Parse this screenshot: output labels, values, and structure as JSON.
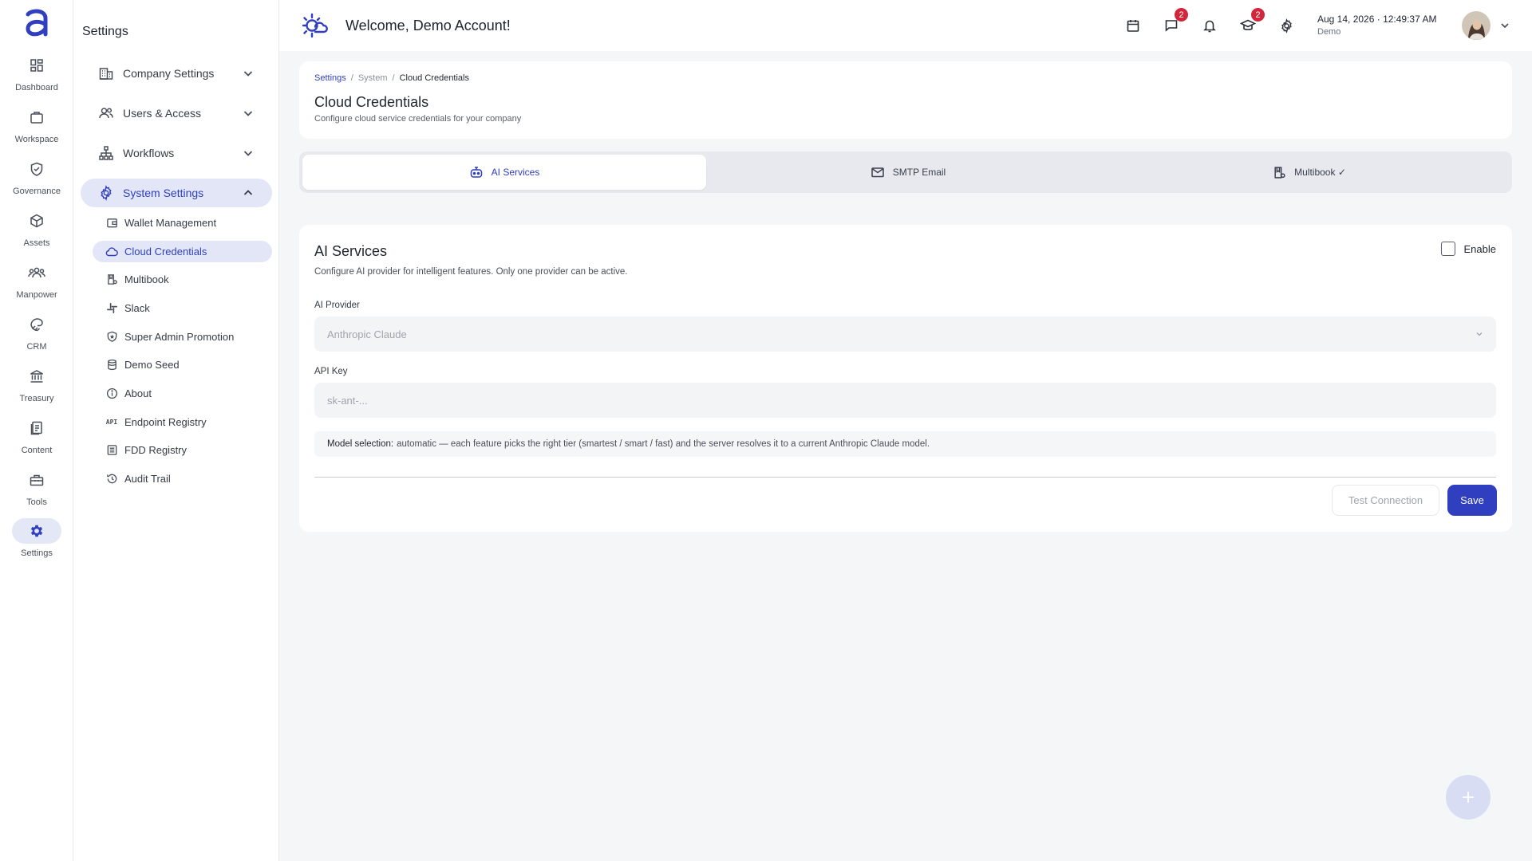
{
  "rail": {
    "items": [
      {
        "label": "Dashboard",
        "icon": "dashboard-icon"
      },
      {
        "label": "Workspace",
        "icon": "briefcase-icon"
      },
      {
        "label": "Governance",
        "icon": "shield-check-icon"
      },
      {
        "label": "Assets",
        "icon": "cube-icon"
      },
      {
        "label": "Manpower",
        "icon": "people-icon"
      },
      {
        "label": "CRM",
        "icon": "handshake-icon"
      },
      {
        "label": "Treasury",
        "icon": "bank-icon"
      },
      {
        "label": "Content",
        "icon": "document-icon"
      },
      {
        "label": "Tools",
        "icon": "toolbox-icon"
      },
      {
        "label": "Settings",
        "icon": "gear-icon",
        "active": true
      }
    ]
  },
  "sidebar": {
    "title": "Settings",
    "groups": [
      {
        "label": "Company Settings",
        "icon": "building-icon"
      },
      {
        "label": "Users & Access",
        "icon": "users-icon"
      },
      {
        "label": "Workflows",
        "icon": "hierarchy-icon"
      },
      {
        "label": "System Settings",
        "icon": "gear-icon",
        "open": true
      }
    ],
    "items": [
      {
        "label": "Wallet Management",
        "icon": "wallet-icon"
      },
      {
        "label": "Cloud Credentials",
        "icon": "cloud-icon",
        "active": true
      },
      {
        "label": "Multibook",
        "icon": "book-icon"
      },
      {
        "label": "Slack",
        "icon": "slack-icon"
      },
      {
        "label": "Super Admin Promotion",
        "icon": "shield-star-icon"
      },
      {
        "label": "Demo Seed",
        "icon": "database-icon"
      },
      {
        "label": "About",
        "icon": "info-icon"
      },
      {
        "label": "Endpoint Registry",
        "icon": "api-icon",
        "icon_text": "API"
      },
      {
        "label": "FDD Registry",
        "icon": "list-icon"
      },
      {
        "label": "Audit Trail",
        "icon": "history-icon"
      }
    ]
  },
  "topbar": {
    "welcome": "Welcome, Demo Account!",
    "chat_badge": "2",
    "learning_badge": "2",
    "date": "Aug 14, 2026 · ",
    "time": "12:49:37 AM",
    "tenant": "Demo"
  },
  "header": {
    "breadcrumb": [
      "Settings",
      "System",
      "Cloud Credentials"
    ],
    "breadcrumb_sep": "/",
    "title": "Cloud Credentials",
    "subtitle": "Configure cloud service credentials for your company"
  },
  "tabs": [
    {
      "label": "AI Services",
      "icon": "robot-icon",
      "active": true
    },
    {
      "label": "SMTP Email",
      "icon": "mail-icon"
    },
    {
      "label": "Multibook ✓",
      "icon": "book-icon"
    }
  ],
  "ai": {
    "title": "AI Services",
    "description": "Configure AI provider for intelligent features. Only one provider can be active.",
    "enable_label": "Enable",
    "enabled": false,
    "provider_label": "AI Provider",
    "provider_value": "Anthropic Claude",
    "api_key_label": "API Key",
    "api_key_placeholder": "sk-ant-...",
    "note_bold": "Model selection:",
    "note_text": "automatic — each feature picks the right tier (smartest / smart / fast) and the server resolves it to a current Anthropic Claude model.",
    "test_button": "Test Connection",
    "save_button": "Save"
  },
  "colors": {
    "accent": "#2f3fbf",
    "accent_soft": "#e2e6f6",
    "badge": "#d2263a",
    "page_bg": "#f5f6f8"
  }
}
